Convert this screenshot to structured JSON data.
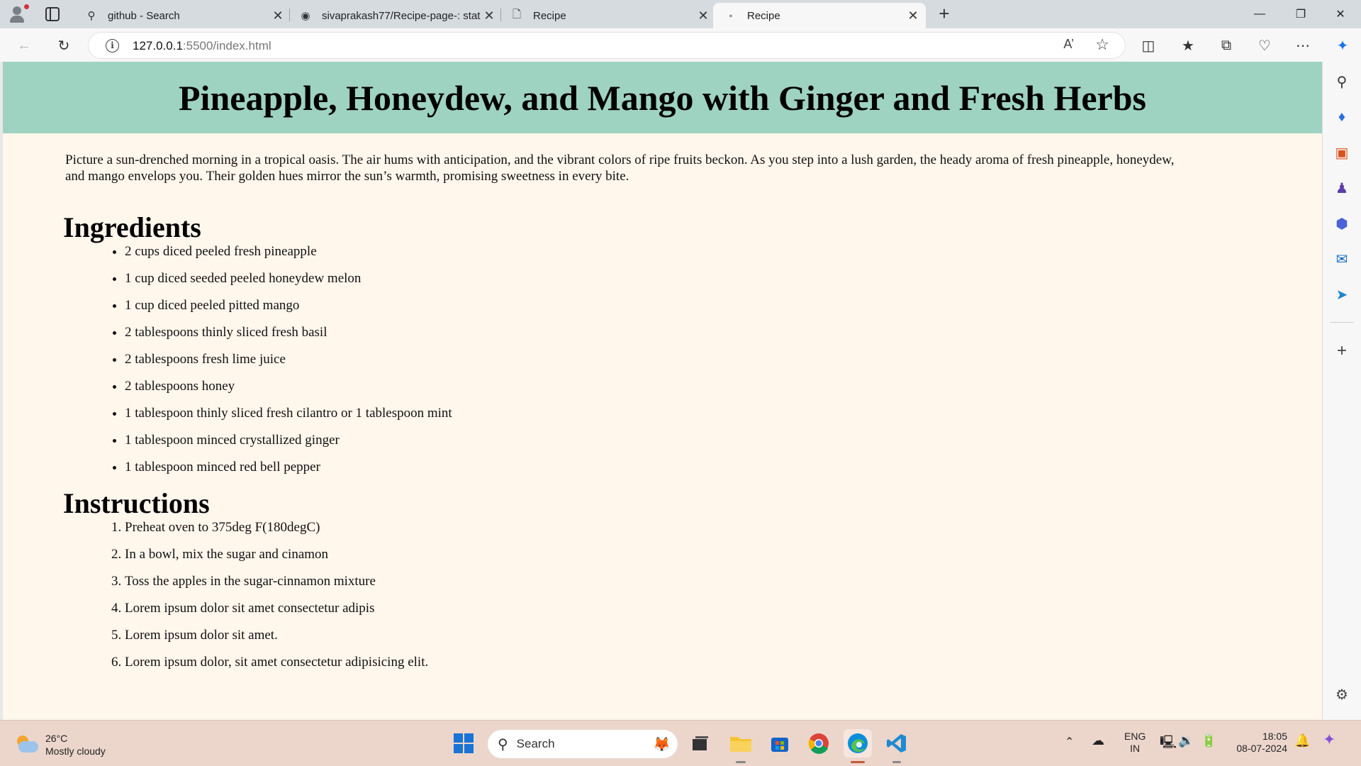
{
  "browser": {
    "tabs": [
      {
        "title": "github - Search",
        "icon": "search-icon"
      },
      {
        "title": "sivaprakash77/Recipe-page-: stat",
        "icon": "github-icon"
      },
      {
        "title": "Recipe",
        "icon": "page-icon"
      },
      {
        "title": "Recipe",
        "icon": "page-icon",
        "active": true
      }
    ],
    "url_host": "127.0.0.1",
    "url_path": ":5500/index.html"
  },
  "page": {
    "title": "Pineapple, Honeydew, and Mango with Ginger and Fresh Herbs",
    "intro": "Picture a sun-drenched morning in a tropical oasis. The air hums with anticipation, and the vibrant colors of ripe fruits beckon. As you step into a lush garden, the heady aroma of fresh pineapple, honeydew, and mango envelops you. Their golden hues mirror the sun’s warmth, promising sweetness in every bite.",
    "ingredients_heading": "Ingredients",
    "ingredients": [
      "2 cups diced peeled fresh pineapple",
      "1 cup diced seeded peeled honeydew melon",
      "1 cup diced peeled pitted mango",
      "2 tablespoons thinly sliced fresh basil",
      "2 tablespoons fresh lime juice",
      "2 tablespoons honey",
      "1 tablespoon thinly sliced fresh cilantro or 1 tablespoon mint",
      "1 tablespoon minced crystallized ginger",
      "1 tablespoon minced red bell pepper"
    ],
    "instructions_heading": "Instructions",
    "instructions": [
      "Preheat oven to 375deg F(180degC)",
      "In a bowl, mix the sugar and cinamon",
      "Toss the apples in the sugar-cinnamon mixture",
      "Lorem ipsum dolor sit amet consectetur adipis",
      "Lorem ipsum dolor sit amet.",
      "Lorem ipsum dolor, sit amet consectetur adipisicing elit."
    ],
    "header_color": "#9fd3c1",
    "background_color": "#fff6ec"
  },
  "taskbar": {
    "weather_temp": "26°C",
    "weather_desc": "Mostly cloudy",
    "search_placeholder": "Search",
    "lang_top": "ENG",
    "lang_bottom": "IN",
    "time": "18:05",
    "date": "08-07-2024"
  }
}
